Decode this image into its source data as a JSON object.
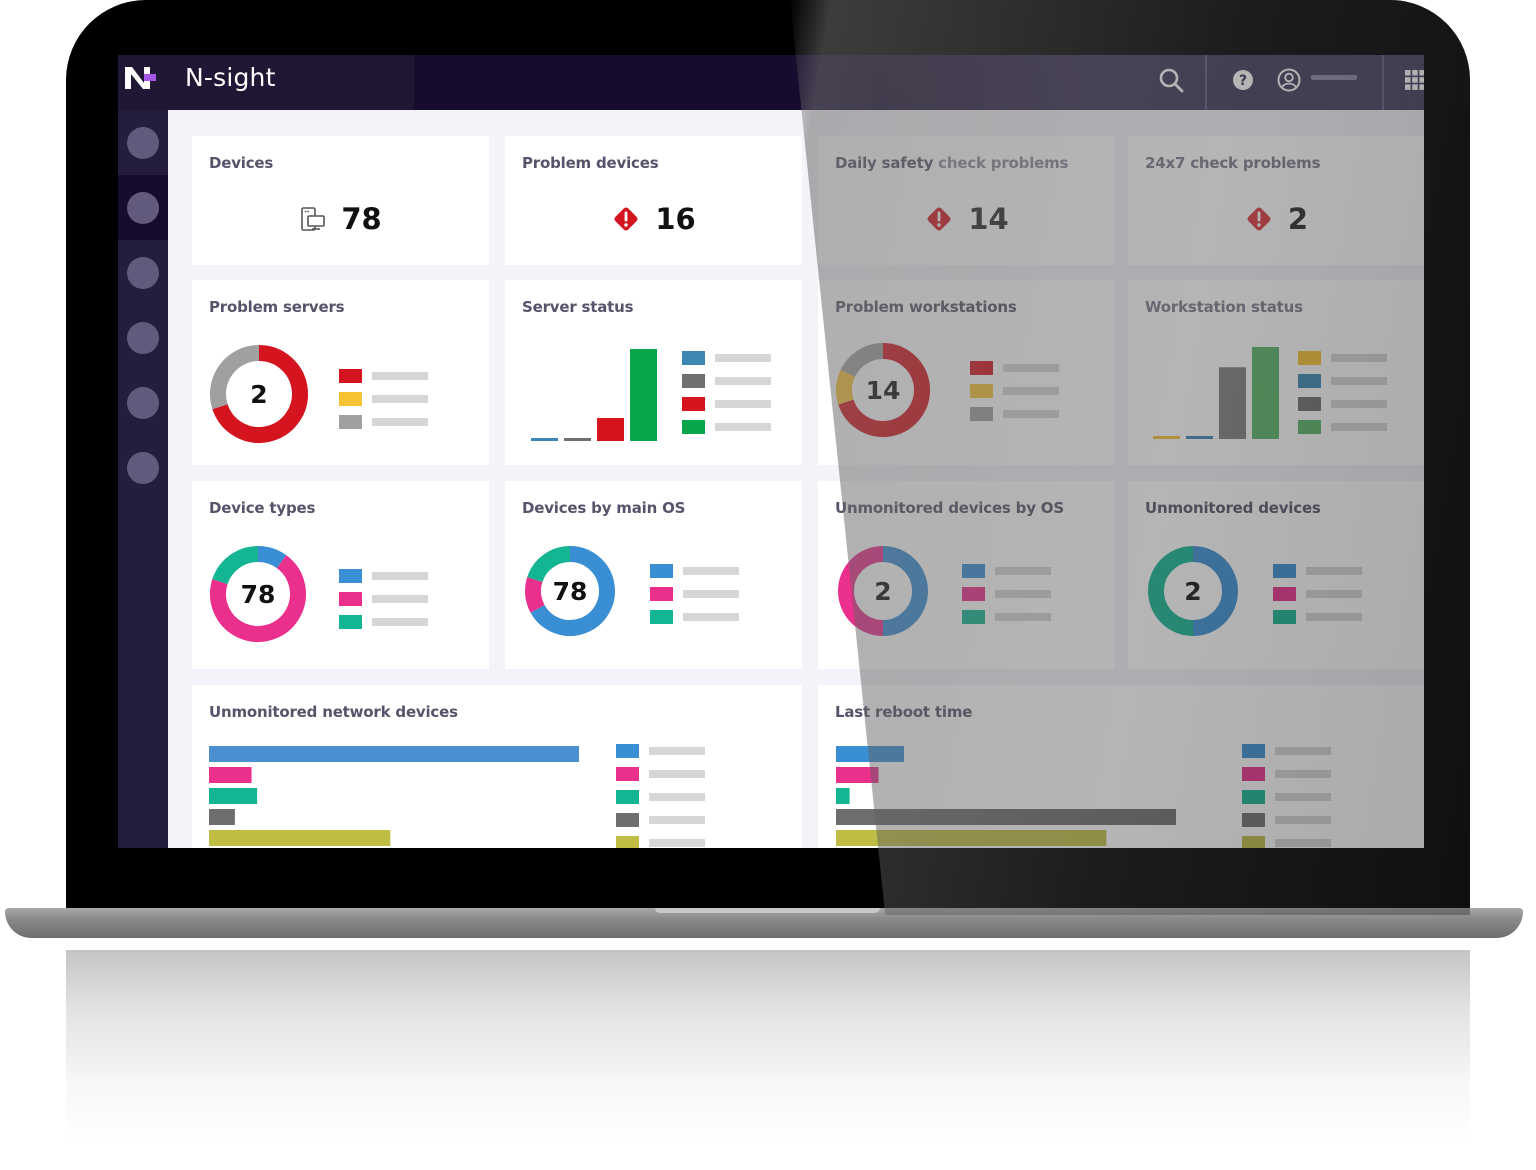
{
  "app": {
    "title": "N-sight",
    "logo_icon": "n-sight-logo-icon"
  },
  "topbar": {
    "icons": [
      "search-icon",
      "help-icon",
      "user-icon",
      "apps-grid-icon"
    ],
    "user_name": ""
  },
  "sidebar": {
    "items": [
      {
        "icon": "nav-dot-icon",
        "active": false
      },
      {
        "icon": "nav-dot-icon",
        "active": true
      },
      {
        "icon": "nav-dot-icon",
        "active": false
      },
      {
        "icon": "nav-dot-icon",
        "active": false
      },
      {
        "icon": "nav-dot-icon",
        "active": false
      },
      {
        "icon": "nav-dot-icon",
        "active": false
      }
    ]
  },
  "colors": {
    "red": "#d4151f",
    "yellow": "#f7c233",
    "gray": "#a0a0a0",
    "dark_gray": "#707070",
    "green": "#07a64a",
    "light_green": "#5ab66a",
    "steel_blue": "#3d88b3",
    "blue": "#3a8fd4",
    "pink": "#ea2f8d",
    "teal": "#14b593",
    "olive": "#c0bd45",
    "legend_placeholder": "#d6d6d6"
  },
  "widgets": {
    "devices": {
      "title": "Devices",
      "value": "78",
      "icon": "devices-icon"
    },
    "problem_devices": {
      "title": "Problem devices",
      "value": "16",
      "icon": "alert-diamond-icon"
    },
    "daily_safety": {
      "title_strong": "Daily safety",
      "title_muted": " check problems",
      "value": "14",
      "icon": "alert-diamond-icon"
    },
    "check_24x7": {
      "title": "24x7 check problems",
      "value": "2",
      "icon": "alert-diamond-icon"
    },
    "problem_servers": {
      "title": "Problem servers",
      "center": "2"
    },
    "server_status": {
      "title": "Server status"
    },
    "problem_workstations": {
      "title": "Problem workstations",
      "center": "14"
    },
    "workstation_status": {
      "title": "Workstation status"
    },
    "device_types": {
      "title": "Device types",
      "center": "78"
    },
    "devices_by_os": {
      "title": "Devices by main OS",
      "center": "78"
    },
    "unmonitored_by_os": {
      "title": "Unmonitored devices by OS",
      "center": "2"
    },
    "unmonitored_devices": {
      "title": "Unmonitored devices",
      "center": "2"
    },
    "unmonitored_network": {
      "title": "Unmonitored network devices"
    },
    "last_reboot": {
      "title": "Last reboot time"
    }
  },
  "chart_data": [
    {
      "id": "problem_servers",
      "type": "pie",
      "title": "Problem servers",
      "center_label": "2",
      "slices": [
        {
          "color": "#d4151f",
          "fraction": 0.7
        },
        {
          "color": "#f7c233",
          "fraction": 0.0
        },
        {
          "color": "#a0a0a0",
          "fraction": 0.3
        }
      ],
      "legend": [
        "#d4151f",
        "#f7c233",
        "#a0a0a0"
      ]
    },
    {
      "id": "server_status",
      "type": "bar",
      "title": "Server status",
      "values": [
        0.3,
        0.3,
        2.5,
        10
      ],
      "colors": [
        "#3d88b3",
        "#707070",
        "#d4151f",
        "#07a64a"
      ],
      "ylim": [
        0,
        10
      ],
      "legend": [
        "#3d88b3",
        "#707070",
        "#d4151f",
        "#07a64a"
      ]
    },
    {
      "id": "problem_workstations",
      "type": "pie",
      "title": "Problem workstations",
      "center_label": "14",
      "slices": [
        {
          "color": "#d4151f",
          "fraction": 0.7
        },
        {
          "color": "#f7c233",
          "fraction": 0.12
        },
        {
          "color": "#a0a0a0",
          "fraction": 0.18
        }
      ],
      "legend": [
        "#d4151f",
        "#f7c233",
        "#a0a0a0"
      ]
    },
    {
      "id": "workstation_status",
      "type": "bar",
      "title": "Workstation status",
      "values": [
        0.3,
        0.3,
        7.8,
        10
      ],
      "colors": [
        "#f7c233",
        "#3d88b3",
        "#808080",
        "#5ab66a"
      ],
      "ylim": [
        0,
        10
      ],
      "legend": [
        "#f7c233",
        "#3d88b3",
        "#707070",
        "#5ab66a"
      ]
    },
    {
      "id": "device_types",
      "type": "pie",
      "title": "Device types",
      "center_label": "78",
      "slices": [
        {
          "color": "#ea2f8d",
          "fraction": 0.7
        },
        {
          "color": "#14b593",
          "fraction": 0.2
        },
        {
          "color": "#3a8fd4",
          "fraction": 0.1
        }
      ],
      "start_fraction": 0.1,
      "legend": [
        "#3a8fd4",
        "#ea2f8d",
        "#14b593"
      ]
    },
    {
      "id": "devices_by_os",
      "type": "pie",
      "title": "Devices by main OS",
      "center_label": "78",
      "slices": [
        {
          "color": "#3a8fd4",
          "fraction": 0.67
        },
        {
          "color": "#ea2f8d",
          "fraction": 0.13
        },
        {
          "color": "#14b593",
          "fraction": 0.2
        }
      ],
      "legend": [
        "#3a8fd4",
        "#ea2f8d",
        "#14b593"
      ]
    },
    {
      "id": "unmonitored_by_os",
      "type": "pie",
      "title": "Unmonitored devices by OS",
      "center_label": "2",
      "slices": [
        {
          "color": "#3a8fd4",
          "fraction": 0.5
        },
        {
          "color": "#ea2f8d",
          "fraction": 0.5
        }
      ],
      "legend": [
        "#3a8fd4",
        "#ea2f8d",
        "#14b593"
      ]
    },
    {
      "id": "unmonitored_devices",
      "type": "pie",
      "title": "Unmonitored devices",
      "center_label": "2",
      "slices": [
        {
          "color": "#3a8fd4",
          "fraction": 0.5
        },
        {
          "color": "#14b593",
          "fraction": 0.5
        }
      ],
      "legend": [
        "#3a8fd4",
        "#ea2f8d",
        "#14b593"
      ]
    },
    {
      "id": "unmonitored_network",
      "type": "bar",
      "orientation": "horizontal",
      "title": "Unmonitored network devices",
      "values": [
        100,
        11.5,
        13,
        7,
        49
      ],
      "colors": [
        "#4a8fd0",
        "#ea2f8d",
        "#14b593",
        "#6e6e6e",
        "#c0bd45"
      ],
      "xlim": [
        0,
        100
      ],
      "legend": [
        "#3a8fd4",
        "#ea2f8d",
        "#14b593",
        "#6e6e6e",
        "#c0bd45"
      ]
    },
    {
      "id": "last_reboot",
      "type": "bar",
      "orientation": "horizontal",
      "title": "Last reboot time",
      "values": [
        20,
        12.5,
        4,
        100,
        79.5
      ],
      "colors": [
        "#3a8fd4",
        "#ea2f8d",
        "#14b593",
        "#6e6e6e",
        "#c0bd45"
      ],
      "xlim": [
        0,
        100
      ],
      "legend": [
        "#3a8fd4",
        "#ea2f8d",
        "#14b593",
        "#6e6e6e",
        "#c0bd45"
      ]
    }
  ]
}
